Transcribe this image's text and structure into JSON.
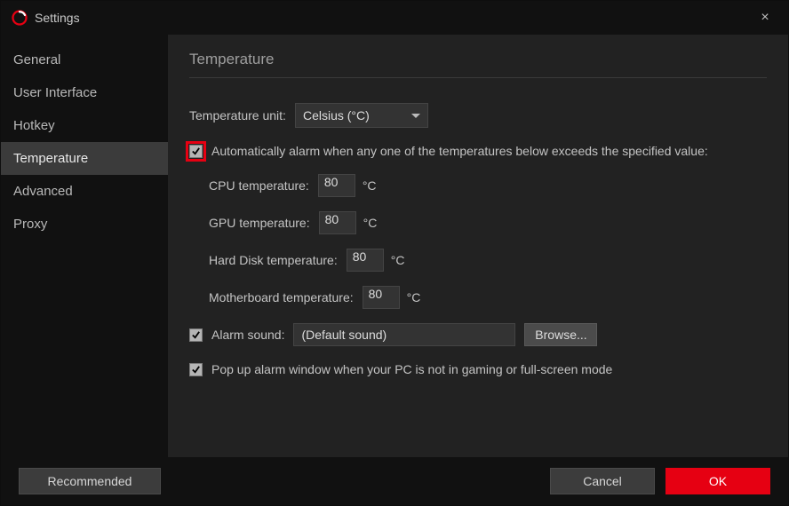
{
  "titlebar": {
    "title": "Settings",
    "close_icon": "×"
  },
  "sidebar": {
    "items": [
      {
        "label": "General",
        "active": false
      },
      {
        "label": "User Interface",
        "active": false
      },
      {
        "label": "Hotkey",
        "active": false
      },
      {
        "label": "Temperature",
        "active": true
      },
      {
        "label": "Advanced",
        "active": false
      },
      {
        "label": "Proxy",
        "active": false
      }
    ]
  },
  "main": {
    "page_title": "Temperature",
    "unit_row": {
      "label": "Temperature unit:",
      "value": "Celsius (°C)"
    },
    "auto_alarm": {
      "checked": true,
      "label": "Automatically alarm when any one of the temperatures below exceeds the specified value:"
    },
    "fields": {
      "cpu": {
        "label": "CPU temperature:",
        "value": "80",
        "unit": "°C"
      },
      "gpu": {
        "label": "GPU temperature:",
        "value": "80",
        "unit": "°C"
      },
      "hdd": {
        "label": "Hard Disk temperature:",
        "value": "80",
        "unit": "°C"
      },
      "mb": {
        "label": "Motherboard temperature:",
        "value": "80",
        "unit": "°C"
      }
    },
    "alarm_sound": {
      "checked": true,
      "label": "Alarm sound:",
      "value": "(Default sound)",
      "browse": "Browse..."
    },
    "popup": {
      "checked": true,
      "label": "Pop up alarm window when your PC is not in gaming or full-screen mode"
    }
  },
  "footer": {
    "recommended": "Recommended",
    "cancel": "Cancel",
    "ok": "OK"
  }
}
